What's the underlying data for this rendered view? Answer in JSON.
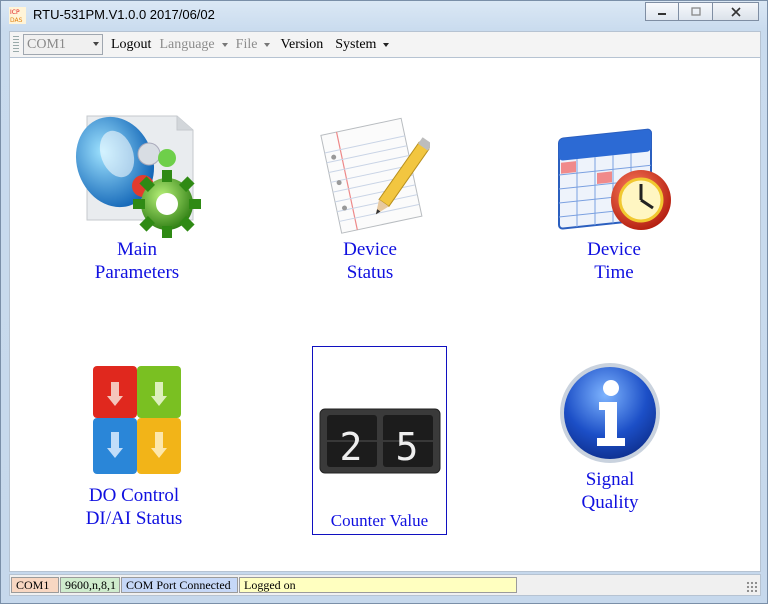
{
  "window": {
    "title": "RTU-531PM.V1.0.0 2017/06/02"
  },
  "menubar": {
    "port_combo": {
      "selected": "COM1"
    },
    "items": [
      {
        "label": "Logout",
        "enabled": true,
        "has_caret": false
      },
      {
        "label": "Language",
        "enabled": false,
        "has_caret": true
      },
      {
        "label": "File",
        "enabled": false,
        "has_caret": true
      },
      {
        "label": "Version",
        "enabled": true,
        "has_caret": false
      },
      {
        "label": "System",
        "enabled": true,
        "has_caret": true
      }
    ]
  },
  "tiles": {
    "main_parameters": {
      "line1": "Main",
      "line2": "Parameters",
      "icon": "settings-gear-icon"
    },
    "device_status": {
      "line1": "Device",
      "line2": "Status",
      "icon": "notepad-pencil-icon"
    },
    "device_time": {
      "line1": "Device",
      "line2": "Time",
      "icon": "calendar-clock-icon"
    },
    "do_control": {
      "line1": "DO Control",
      "line2": "DI/AI Status",
      "icon": "switches-icon"
    },
    "counter_value": {
      "label": "Counter Value",
      "digits": [
        "2",
        "5"
      ],
      "icon": "counter-display-icon"
    },
    "signal_quality": {
      "line1": "Signal",
      "line2": "Quality",
      "icon": "info-icon"
    }
  },
  "statusbar": {
    "port": "COM1",
    "serial": "9600,n,8,1",
    "connection": "COM Port Connected",
    "login": "Logged on"
  },
  "colors": {
    "label_blue": "#1010e0",
    "status_port": "#f8d7c2",
    "status_serial": "#cfeccd",
    "status_connection": "#c6d8f7",
    "status_login": "#ffffc0"
  }
}
